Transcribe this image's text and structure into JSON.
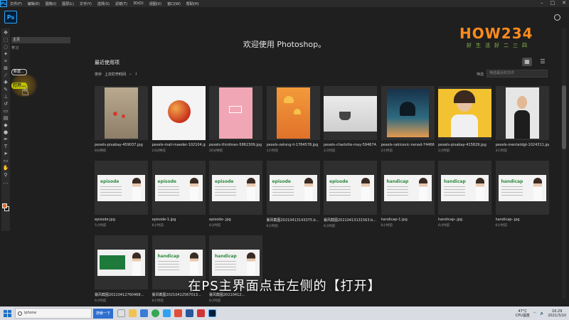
{
  "menu": [
    "文件(F)",
    "编辑(E)",
    "图像(I)",
    "图层(L)",
    "文字(Y)",
    "选择(S)",
    "滤镜(T)",
    "3D(D)",
    "视图(V)",
    "窗口(W)",
    "帮助(H)"
  ],
  "app_badge": "Ps",
  "left_panel": {
    "home": "主页",
    "learn": "学习",
    "new_label": "新建...",
    "open_label": "打开..."
  },
  "welcome_title": "欢迎使用 Photoshop。",
  "recent_title": "最近使用项",
  "sort": {
    "label": "排序",
    "value": "上次打开时间"
  },
  "filter": {
    "label": "筛选",
    "placeholder": "筛选最近的文件"
  },
  "files": [
    {
      "name": "pexels-pixabay-459037.jpg",
      "time": "8分钟前",
      "art": "flowers"
    },
    {
      "name": "pexels-mali-maeder-102104.jpg",
      "time": "14分钟前",
      "art": "apple"
    },
    {
      "name": "pexels-thirdman-5862309.jpg",
      "time": "26分钟前",
      "art": "pink"
    },
    {
      "name": "pexels-zetong-li-1784578.jpg",
      "time": "1小时前",
      "art": "jelly"
    },
    {
      "name": "pexels-charlotte-may-594674...",
      "time": "2小时前",
      "art": "cup"
    },
    {
      "name": "pexels-rakicevic-nenad-74466...",
      "time": "2小时前",
      "art": "sunset"
    },
    {
      "name": "pexels-pixabay-415829.jpg",
      "time": "2小时前",
      "art": "woman-yellow"
    },
    {
      "name": "pexels-mentatdgt-1024311.jpg",
      "time": "3小时前",
      "art": "woman-grey"
    },
    {
      "name": "episode.jpg",
      "time": "5小时前",
      "art": "episode"
    },
    {
      "name": "episode-1.jpg",
      "time": "6小时前",
      "art": "episode"
    },
    {
      "name": "episode-.jpg",
      "time": "6小时前",
      "art": "episode"
    },
    {
      "name": "暴风截图20210413143375.b...",
      "time": "6小时前",
      "art": "episode"
    },
    {
      "name": "暴风截图20210413131563.b...",
      "time": "6小时前",
      "art": "episode"
    },
    {
      "name": "handicap-1.jpg",
      "time": "6小时前",
      "art": "handicap"
    },
    {
      "name": "handicap-.jpg",
      "time": "6小时前",
      "art": "handicap"
    },
    {
      "name": "handicap-.jpg",
      "time": "6小时前",
      "art": "handicap"
    },
    {
      "name": "暴风截图20210412760468...",
      "time": "6小时前",
      "art": "green"
    },
    {
      "name": "暴风截图20210412567013...",
      "time": "6小时前",
      "art": "handicap"
    },
    {
      "name": "暴风截图20210412...",
      "time": "6小时前",
      "art": "handicap"
    }
  ],
  "slide_words": {
    "episode": "episode",
    "handicap": "handicap"
  },
  "subtitle": "在PS主界面点击左侧的【打开】",
  "watermark": {
    "brand": "HOW234",
    "tagline": "好生活好二三四"
  },
  "taskbar": {
    "search_text": "iphone",
    "search_button": "搜索一下",
    "weather": "47°C",
    "cpu": "CPU温度",
    "time": "16:29",
    "date": "2021/3/10"
  },
  "colors": {
    "accent": "#31a8ff",
    "open_button": "#c0c000",
    "bg": "#1f1f1f"
  }
}
